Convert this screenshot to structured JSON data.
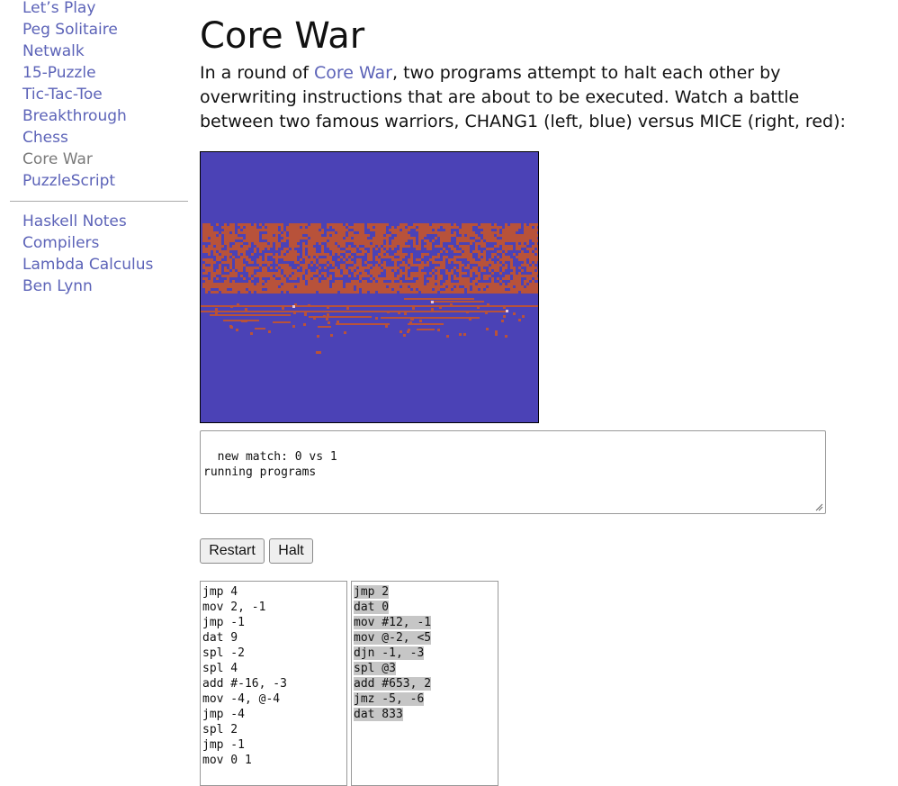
{
  "nav": {
    "games": [
      "Let’s Play",
      "Peg Solitaire",
      "Netwalk",
      "15-Puzzle",
      "Tic-Tac-Toe",
      "Breakthrough",
      "Chess",
      "Core War",
      "PuzzleScript"
    ],
    "current": "Core War",
    "other": [
      "Haskell Notes",
      "Compilers",
      "Lambda Calculus",
      "Ben Lynn"
    ]
  },
  "page": {
    "title": "Core War",
    "intro_before": "In a round of ",
    "intro_link": "Core War",
    "intro_after": ", two programs attempt to halt each other by overwriting instructions that are about to be executed. Watch a battle between two famous warriors, CHANG1 (left, blue) versus MICE (right, red):"
  },
  "core": {
    "background_color": "#4b42b6",
    "red_color": "#b8523a"
  },
  "log": {
    "text": "new match: 0 vs 1\nrunning programs"
  },
  "buttons": {
    "restart": "Restart",
    "halt": "Halt"
  },
  "programs": {
    "left": [
      "jmp 4",
      "mov 2, -1",
      "jmp -1",
      "dat 9",
      "spl -2",
      "spl 4",
      "add #-16, -3",
      "mov -4, @-4",
      "jmp -4",
      "spl 2",
      "jmp -1",
      "mov 0 1"
    ],
    "right": [
      "jmp 2",
      "dat 0",
      "mov #12, -1",
      "mov @-2, <5",
      "djn -1, -3",
      "spl @3",
      "add #653, 2",
      "jmz -5, -6",
      "dat 833"
    ]
  }
}
